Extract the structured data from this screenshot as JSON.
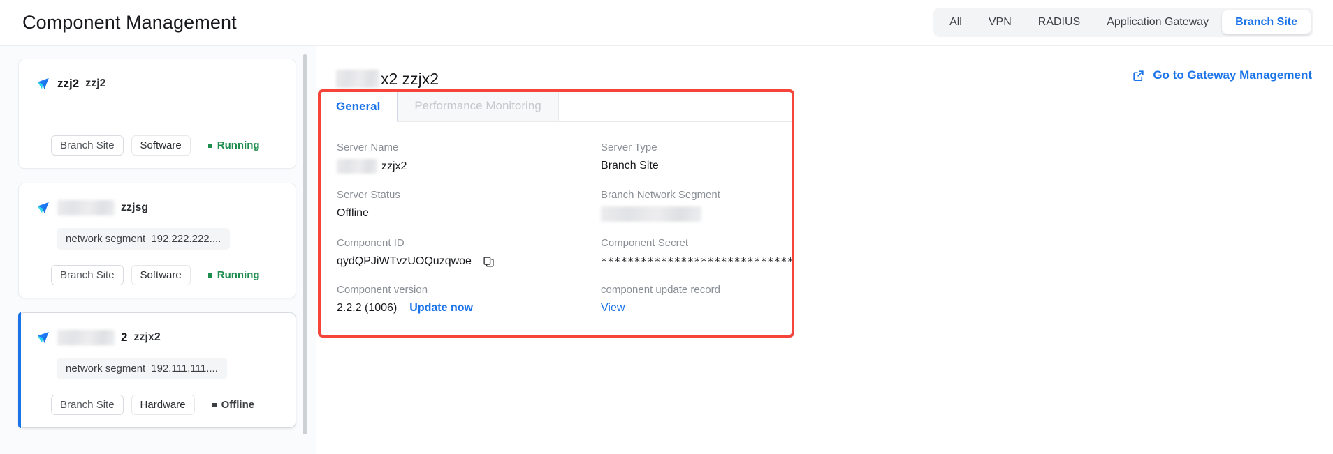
{
  "header": {
    "title": "Component Management",
    "filter_tabs": [
      {
        "label": "All",
        "active": false
      },
      {
        "label": "VPN",
        "active": false
      },
      {
        "label": "RADIUS",
        "active": false
      },
      {
        "label": "Application Gateway",
        "active": false
      },
      {
        "label": "Branch Site",
        "active": true
      }
    ]
  },
  "sidebar": {
    "cards": [
      {
        "name": "zzj2",
        "sub": "zzj2",
        "redacted_name": false,
        "network_segment_label": "",
        "network_segment_value": "",
        "has_segment": false,
        "tags": [
          "Branch Site",
          "Software"
        ],
        "status": "Running",
        "status_kind": "running",
        "selected": false
      },
      {
        "name": "",
        "sub": "zzjsg",
        "redacted_name": true,
        "network_segment_label": "network segment",
        "network_segment_value": "192.222.222....",
        "has_segment": true,
        "tags": [
          "Branch Site",
          "Software"
        ],
        "status": "Running",
        "status_kind": "running",
        "selected": false
      },
      {
        "name": "2",
        "sub": "zzjx2",
        "redacted_name": true,
        "network_segment_label": "network segment",
        "network_segment_value": "192.111.111....",
        "has_segment": true,
        "tags": [
          "Branch Site",
          "Hardware"
        ],
        "status": "Offline",
        "status_kind": "offline",
        "selected": true
      }
    ]
  },
  "main": {
    "title_suffix": "x2 zzjx2",
    "gateway_link": "Go to Gateway Management",
    "tabs": [
      {
        "label": "General",
        "active": true
      },
      {
        "label": "Performance Monitoring",
        "active": false
      }
    ],
    "fields": {
      "server_name_label": "Server Name",
      "server_name_value": "zzjx2",
      "server_type_label": "Server Type",
      "server_type_value": "Branch Site",
      "server_status_label": "Server Status",
      "server_status_value": "Offline",
      "branch_network_segment_label": "Branch Network Segment",
      "branch_network_segment_value": "",
      "component_id_label": "Component ID",
      "component_id_value": "qydQPJiWTvzUOQuzqwoe",
      "component_secret_label": "Component Secret",
      "component_secret_value": "*******************************",
      "component_version_label": "Component version",
      "component_version_value": "2.2.2 (1006)",
      "update_now_label": "Update now",
      "update_record_label": "component update record",
      "view_label": "View"
    }
  },
  "colors": {
    "accent": "#1a73e8",
    "highlight": "#f5453b",
    "running": "#1e8e4e",
    "offline": "#3c4043"
  }
}
